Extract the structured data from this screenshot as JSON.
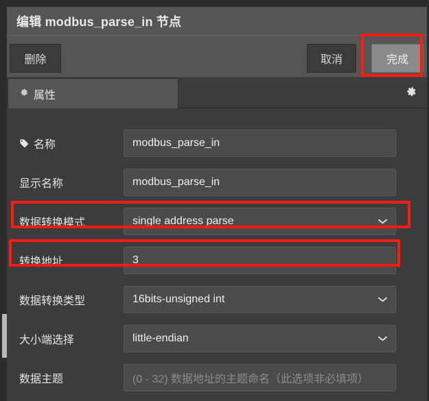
{
  "window": {
    "title": "编辑 modbus_parse_in 节点"
  },
  "toolbar": {
    "delete_label": "删除",
    "cancel_label": "取消",
    "done_label": "完成"
  },
  "tabs": [
    {
      "label": "属性",
      "icon": "gear-icon",
      "active": true
    }
  ],
  "header_actions": {
    "settings_icon": "gear-icon"
  },
  "form": {
    "rows": [
      {
        "label": "名称",
        "icon": "tag-icon",
        "type": "text",
        "value": "modbus_parse_in",
        "placeholder": "",
        "highlighted": false
      },
      {
        "label": "显示名称",
        "icon": "",
        "type": "text",
        "value": "modbus_parse_in",
        "placeholder": "",
        "highlighted": false
      },
      {
        "label": "数据转换模式",
        "icon": "",
        "type": "select",
        "value": "single address parse",
        "placeholder": "",
        "highlighted": true
      },
      {
        "label": "转换地址",
        "icon": "",
        "type": "text",
        "value": "3",
        "placeholder": "",
        "highlighted": true
      },
      {
        "label": "数据转换类型",
        "icon": "",
        "type": "select",
        "value": "16bits-unsigned int",
        "placeholder": "",
        "highlighted": false
      },
      {
        "label": "大小端选择",
        "icon": "",
        "type": "select",
        "value": "little-endian",
        "placeholder": "",
        "highlighted": false
      },
      {
        "label": "数据主题",
        "icon": "",
        "type": "text",
        "value": "",
        "placeholder": "(0 - 32) 数据地址的主题命名（此选项非必填项）",
        "highlighted": false
      }
    ]
  },
  "annotations": {
    "color": "#ff1a12",
    "targets": [
      "完成",
      "数据转换模式",
      "转换地址"
    ]
  },
  "colors": {
    "panel_bg": "#3c3c3c",
    "header_bg": "#555555",
    "field_bg": "#4b4b4b",
    "primary_button_bg": "#8a8a8a",
    "highlight": "#ff1a12"
  }
}
